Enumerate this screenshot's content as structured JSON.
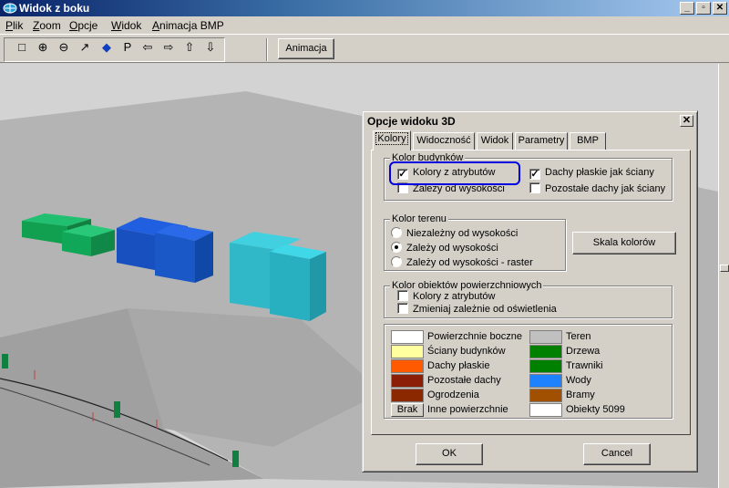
{
  "window": {
    "title": "Widok z boku",
    "buttons": {
      "minimize": "_",
      "maximize": "▫",
      "close": "✕"
    }
  },
  "menu": [
    {
      "pre": "",
      "u": "P",
      "post": "lik"
    },
    {
      "pre": "",
      "u": "Z",
      "post": "oom"
    },
    {
      "pre": "",
      "u": "O",
      "post": "pcje"
    },
    {
      "pre": "",
      "u": "W",
      "post": "idok"
    },
    {
      "pre": "",
      "u": "A",
      "post": "nimacja BMP"
    }
  ],
  "toolbar": {
    "icons": [
      "□",
      "⊕",
      "⊖",
      "↗",
      "◆",
      "P",
      "⇦",
      "⇨",
      "⇧",
      "⇩"
    ],
    "icon_names": [
      "select-icon",
      "zoom-in-icon",
      "zoom-out-icon",
      "arrow-icon",
      "diamond-icon",
      "p-icon",
      "left-arrow-icon",
      "right-arrow-icon",
      "up-arrow-icon",
      "down-arrow-icon"
    ],
    "animacja_label": "Animacja"
  },
  "dialog": {
    "title": "Opcje widoku 3D",
    "close": "✕",
    "tabs": [
      "Kolory",
      "Widoczność",
      "Widok",
      "Parametry",
      "BMP"
    ],
    "kolor_budynkow": {
      "label": "Kolor budynków",
      "kolory_z_atrybutow": "Kolory z atrybutów",
      "zalezy_od_wysokosci": "Zależy od wysokości",
      "dachy_plaskie": "Dachy płaskie jak ściany",
      "pozostale_dachy": "Pozostałe dachy jak ściany"
    },
    "kolor_terenu": {
      "label": "Kolor terenu",
      "options": [
        "Niezależny od wysokości",
        "Zależy od wysokości",
        "Zależy od wysokości - raster"
      ]
    },
    "skala_kolorow": "Skala kolorów",
    "kolor_obiektow": {
      "label": "Kolor obiektów powierzchniowych",
      "kolory_z_atrybutow": "Kolory z atrybutów",
      "zmieniaj": "Zmieniaj zależnie od oświetlenia"
    },
    "legend_left": [
      {
        "label": "Powierzchnie boczne",
        "color": "#ffffff"
      },
      {
        "label": "Ściany budynków",
        "color": "#ffffa0"
      },
      {
        "label": "Dachy płaskie",
        "color": "#ff5a00"
      },
      {
        "label": "Pozostałe dachy",
        "color": "#8c1e08"
      },
      {
        "label": "Ogrodzenia",
        "color": "#8c2800"
      },
      {
        "label": "Inne powierzchnie",
        "color": "#d4d0c8",
        "swatch_text": "Brak"
      }
    ],
    "legend_right": [
      {
        "label": "Teren",
        "color": "#c0c0c0"
      },
      {
        "label": "Drzewa",
        "color": "#008000"
      },
      {
        "label": "Trawniki",
        "color": "#008000"
      },
      {
        "label": "Wody",
        "color": "#1e82ff"
      },
      {
        "label": "Bramy",
        "color": "#a05000"
      },
      {
        "label": "Obiekty 5099",
        "color": "#ffffff"
      }
    ],
    "ok": "OK",
    "cancel": "Cancel"
  }
}
